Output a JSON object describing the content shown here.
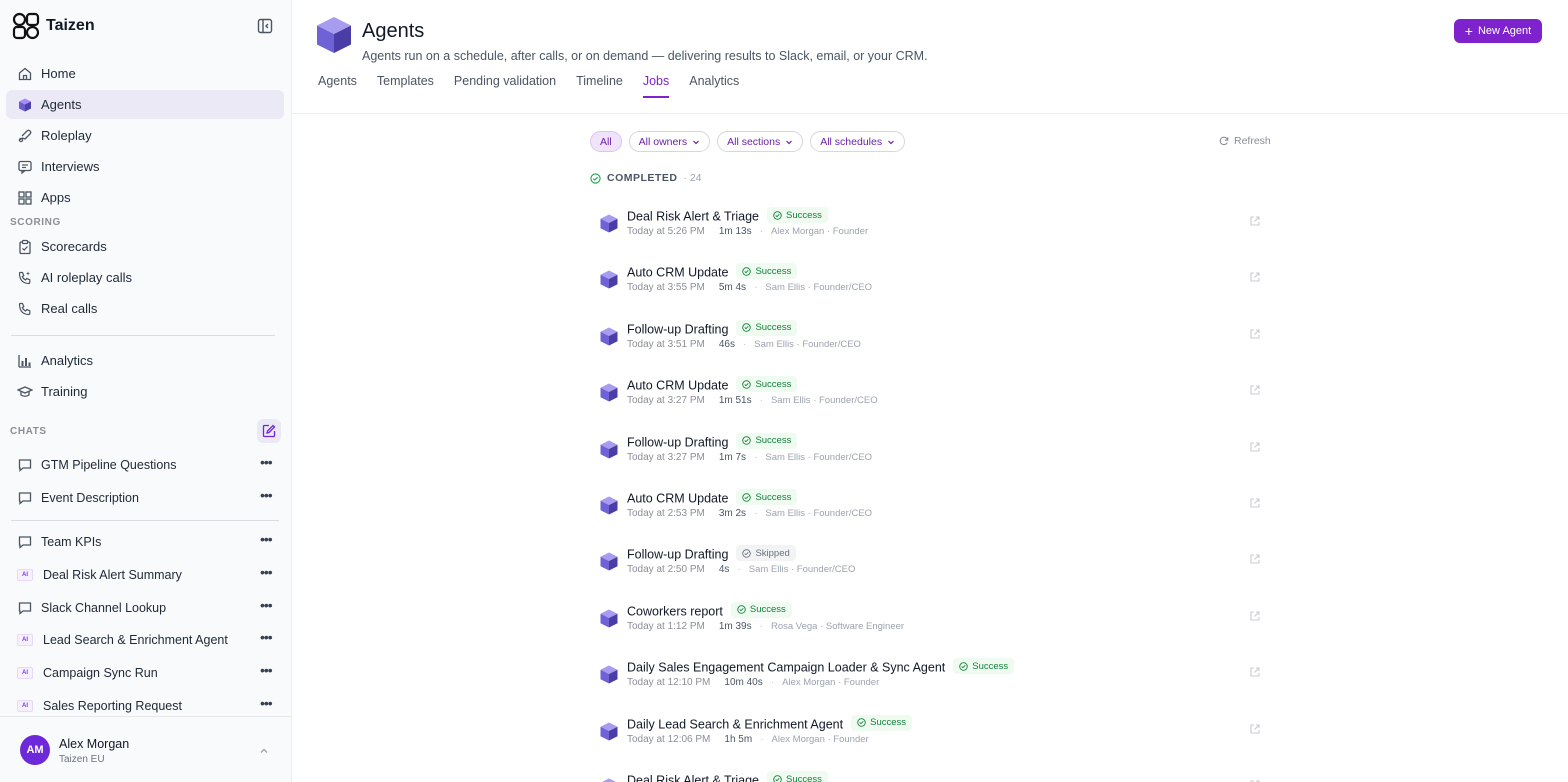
{
  "sidebar": {
    "brand": "Taizen",
    "nav": [
      {
        "label": "Home",
        "icon": "home-icon"
      },
      {
        "label": "Agents",
        "icon": "agents-cube-icon"
      },
      {
        "label": "Roleplay",
        "icon": "roleplay-icon"
      },
      {
        "label": "Interviews",
        "icon": "interviews-icon"
      },
      {
        "label": "Apps",
        "icon": "apps-grid-icon"
      }
    ],
    "scoring_label": "SCORING",
    "scoring": [
      {
        "label": "Scorecards",
        "icon": "clipboard-icon"
      },
      {
        "label": "AI roleplay calls",
        "icon": "ai-phone-icon"
      },
      {
        "label": "Real calls",
        "icon": "phone-icon"
      }
    ],
    "more": [
      {
        "label": "Analytics",
        "icon": "bar-chart-icon"
      },
      {
        "label": "Training",
        "icon": "graduation-cap-icon"
      }
    ],
    "chats_label": "CHATS",
    "chats": [
      {
        "label": "GTM Pipeline Questions",
        "kind": "chat"
      },
      {
        "label": "Event Description",
        "kind": "chat"
      },
      {
        "label": "Team KPIs",
        "kind": "chat"
      },
      {
        "label": "Deal Risk Alert Summary",
        "kind": "ai"
      },
      {
        "label": "Slack Channel Lookup",
        "kind": "chat"
      },
      {
        "label": "Lead Search & Enrichment Agent",
        "kind": "ai"
      },
      {
        "label": "Campaign Sync Run",
        "kind": "ai"
      },
      {
        "label": "Sales Reporting Request",
        "kind": "ai"
      }
    ],
    "ai_badge": "AI",
    "user": {
      "initials": "AM",
      "name": "Alex Morgan",
      "org": "Taizen EU"
    }
  },
  "header": {
    "title": "Agents",
    "subtitle": "Agents run on a schedule, after calls, or on demand — delivering results to Slack, email, or your CRM.",
    "new_agent_label": "New Agent",
    "tabs": [
      "Agents",
      "Templates",
      "Pending validation",
      "Timeline",
      "Jobs",
      "Analytics"
    ],
    "active_tab": "Jobs"
  },
  "filters": {
    "chips": [
      "All",
      "All owners",
      "All sections",
      "All schedules"
    ],
    "refresh_label": "Refresh"
  },
  "group": {
    "title": "COMPLETED",
    "count": "· 24"
  },
  "jobs": [
    {
      "name": "Deal Risk Alert & Triage",
      "status": "Success",
      "time": "Today at 5:26 PM",
      "duration": "1m 13s",
      "who": "Alex Morgan · Founder"
    },
    {
      "name": "Auto CRM Update",
      "status": "Success",
      "time": "Today at 3:55 PM",
      "duration": "5m 4s",
      "who": "Sam Ellis · Founder/CEO"
    },
    {
      "name": "Follow-up Drafting",
      "status": "Success",
      "time": "Today at 3:51 PM",
      "duration": "46s",
      "who": "Sam Ellis · Founder/CEO"
    },
    {
      "name": "Auto CRM Update",
      "status": "Success",
      "time": "Today at 3:27 PM",
      "duration": "1m 51s",
      "who": "Sam Ellis · Founder/CEO"
    },
    {
      "name": "Follow-up Drafting",
      "status": "Success",
      "time": "Today at 3:27 PM",
      "duration": "1m 7s",
      "who": "Sam Ellis · Founder/CEO"
    },
    {
      "name": "Auto CRM Update",
      "status": "Success",
      "time": "Today at 2:53 PM",
      "duration": "3m 2s",
      "who": "Sam Ellis · Founder/CEO"
    },
    {
      "name": "Follow-up Drafting",
      "status": "Skipped",
      "time": "Today at 2:50 PM",
      "duration": "4s",
      "who": "Sam Ellis · Founder/CEO"
    },
    {
      "name": "Coworkers report",
      "status": "Success",
      "time": "Today at 1:12 PM",
      "duration": "1m 39s",
      "who": "Rosa Vega · Software Engineer"
    },
    {
      "name": "Daily Sales Engagement Campaign Loader & Sync Agent",
      "status": "Success",
      "time": "Today at 12:10 PM",
      "duration": "10m 40s",
      "who": "Alex Morgan · Founder"
    },
    {
      "name": "Daily Lead Search & Enrichment Agent",
      "status": "Success",
      "time": "Today at 12:06 PM",
      "duration": "1h 5m",
      "who": "Alex Morgan · Founder"
    },
    {
      "name": "Deal Risk Alert & Triage",
      "status": "Success",
      "time": "",
      "duration": "",
      "who": ""
    }
  ],
  "colors": {
    "accent": "#7e22ce",
    "success": "#15803d",
    "active_nav_bg": "#ece9f6"
  }
}
